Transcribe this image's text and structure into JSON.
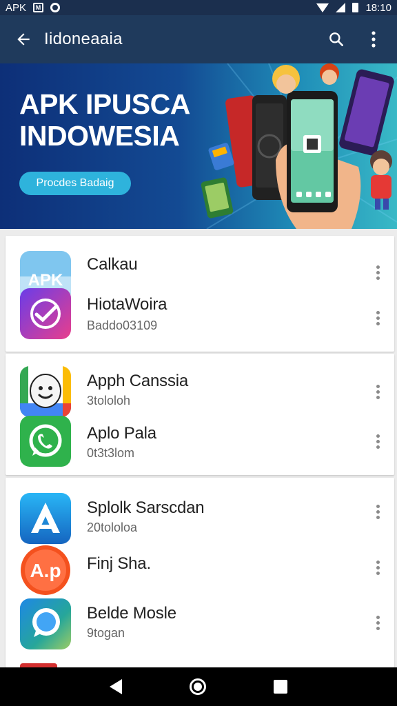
{
  "status_bar": {
    "carrier": "APK",
    "time": "18:10"
  },
  "app_bar": {
    "title": "Iidoneaaia"
  },
  "banner": {
    "headline_line1": "APK IPUSCA",
    "headline_line2": "INDOWESIA",
    "cta_label": "Procdes Badaig"
  },
  "apps": [
    {
      "name": "Calkau",
      "subtitle": "",
      "icon": "apk-icon",
      "icon_text": "APK"
    },
    {
      "name": "HiotaWoira",
      "subtitle": "Baddo03109",
      "icon": "check-app-icon",
      "icon_text": ""
    },
    {
      "name": "Apph Canssia",
      "subtitle": "3tololoh",
      "icon": "face-app-icon",
      "icon_text": ""
    },
    {
      "name": "Aplo Pala",
      "subtitle": "0t3t3lom",
      "icon": "phone-chat-icon",
      "icon_text": ""
    },
    {
      "name": "Splolk Sarscdan",
      "subtitle": "20tololoa",
      "icon": "a-store-icon",
      "icon_text": ""
    },
    {
      "name": "Finj Sha.",
      "subtitle": "",
      "icon": "ap-orange-icon",
      "icon_text": "A.p"
    },
    {
      "name": "Belde Mosle",
      "subtitle": "9togan",
      "icon": "chat-bubble-icon",
      "icon_text": ""
    }
  ],
  "colors": {
    "status_bar": "#1b2f4e",
    "app_bar": "#1f3a5c",
    "banner_start": "#0d2f78",
    "banner_end": "#39b9c6",
    "cta": "#2eb3dc"
  }
}
